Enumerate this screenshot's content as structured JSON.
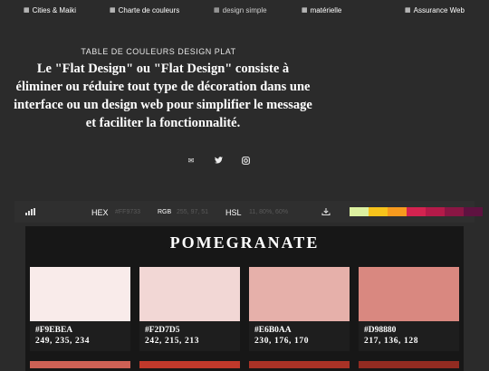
{
  "nav": [
    {
      "icon": "grid-icon",
      "label": "Cities & Maiki",
      "active": false
    },
    {
      "icon": "grid-icon",
      "label": "Charte de couleurs",
      "active": false
    },
    {
      "icon": "grid-icon",
      "label": "design simple",
      "active": true
    },
    {
      "icon": "grid-icon",
      "label": "matérielle",
      "active": false
    },
    {
      "icon": "grid-icon",
      "label": "Assurance Web",
      "active": false
    }
  ],
  "hero": {
    "subtitle": "TABLE DE COULEURS DESIGN PLAT",
    "text": "Le \"Flat Design\" ou \"Flat Design\" consiste à éliminer ou réduire tout type de décoration dans une interface ou un design web pour simplifier le message et faciliter la fonctionnalité."
  },
  "social": [
    {
      "icon": "mail-icon",
      "glyph": "✉"
    },
    {
      "icon": "twitter-icon",
      "glyph": "🐦"
    },
    {
      "icon": "instagram-icon",
      "glyph": "◎"
    }
  ],
  "colorbar": {
    "hex_label": "HEX",
    "hex_value": "#FF9733",
    "rgb_label": "RGB",
    "rgb_value": "255, 97, 51",
    "hsl_label": "HSL",
    "hsl_value": "11, 80%, 60%",
    "swatches": [
      "#dcf0a0",
      "#f7c31b",
      "#f79a1e",
      "#d42350",
      "#b41a49",
      "#8a1644",
      "#5e1240"
    ]
  },
  "palette": {
    "title": "POMEGRANATE",
    "cards": [
      {
        "hex": "#F9EBEA",
        "rgb": "249, 235, 234",
        "color": "#F9EBEA"
      },
      {
        "hex": "#F2D7D5",
        "rgb": "242, 215, 213",
        "color": "#F2D7D5"
      },
      {
        "hex": "#E6B0AA",
        "rgb": "230, 176, 170",
        "color": "#E6B0AA"
      },
      {
        "hex": "#D98880",
        "rgb": "217, 136, 128",
        "color": "#D98880"
      }
    ],
    "next_row_colors": [
      "#CD6155",
      "#C0392B",
      "#A93226",
      "#922B21"
    ]
  }
}
